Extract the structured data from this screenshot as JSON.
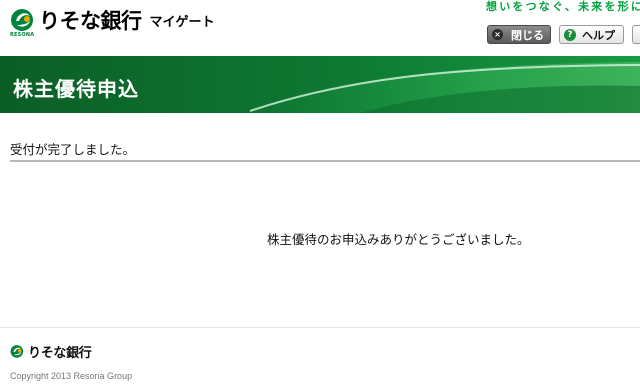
{
  "header": {
    "logo_text": "りそな銀行",
    "logo_sub": "RESONA",
    "app_name": "マイゲート",
    "tagline": "想いをつなぐ、未来を形に",
    "close_label": "閉じる",
    "close_icon_glyph": "×",
    "help_label": "ヘルプ",
    "help_icon_glyph": "?"
  },
  "banner": {
    "title": "株主優待申込"
  },
  "main": {
    "status_text": "受付が完了しました。",
    "message": "株主優待のお申込みありがとうございました。"
  },
  "footer": {
    "logo_text": "りそな銀行",
    "copyright": "Copyright 2013 Resona Group"
  },
  "colors": {
    "brand_green": "#00843d",
    "banner_green": "#084f22",
    "tagline_green": "#00a33f"
  }
}
